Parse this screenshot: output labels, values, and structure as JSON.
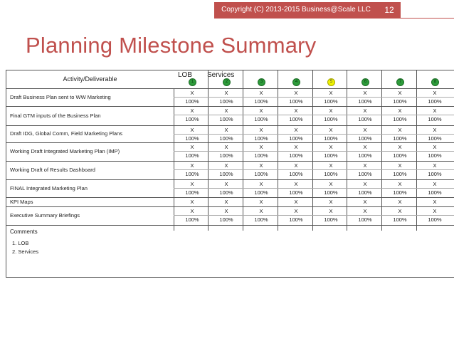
{
  "header": {
    "copyright": "Copyright (C) 2013-2015 Business@Scale LLC",
    "page_number": "12"
  },
  "title": "Planning Milestone Summary",
  "table": {
    "activity_header": "Activity/Deliverable",
    "group_labels": [
      "LOB",
      "Services"
    ],
    "milestones": [
      {
        "num": "1",
        "color": "#2d9b3a"
      },
      {
        "num": "2",
        "color": "#2d9b3a"
      },
      {
        "num": "3",
        "color": "#2d9b3a"
      },
      {
        "num": "4",
        "color": "#2d9b3a"
      },
      {
        "num": "5",
        "color": "#eef200"
      },
      {
        "num": "6",
        "color": "#2d9b3a"
      },
      {
        "num": "7",
        "color": "#2d9b3a"
      },
      {
        "num": "8",
        "color": "#2d9b3a"
      }
    ],
    "rows": [
      {
        "activity": "Draft Business Plan sent to WW Marketing",
        "marks": [
          "X",
          "X",
          "X",
          "X",
          "X",
          "X",
          "X",
          "X"
        ],
        "pct": [
          "100%",
          "100%",
          "100%",
          "100%",
          "100%",
          "100%",
          "100%",
          "100%"
        ]
      },
      {
        "activity": "Final GTM inputs of the Business Plan",
        "marks": [
          "X",
          "X",
          "X",
          "X",
          "X",
          "X",
          "X",
          "X"
        ],
        "pct": [
          "100%",
          "100%",
          "100%",
          "100%",
          "100%",
          "100%",
          "100%",
          "100%"
        ]
      },
      {
        "activity": "Draft IDG, Global Comm, Field Marketing Plans",
        "marks": [
          "X",
          "X",
          "X",
          "X",
          "X",
          "X",
          "X",
          "X"
        ],
        "pct": [
          "100%",
          "100%",
          "100%",
          "100%",
          "100%",
          "100%",
          "100%",
          "100%"
        ]
      },
      {
        "activity": "Working Draft Integrated Marketing Plan (IMP)",
        "marks": [
          "X",
          "X",
          "X",
          "X",
          "X",
          "X",
          "X",
          "X"
        ],
        "pct": [
          "100%",
          "100%",
          "100%",
          "100%",
          "100%",
          "100%",
          "100%",
          "100%"
        ]
      },
      {
        "activity": "Working Draft of Results Dashboard",
        "marks": [
          "X",
          "X",
          "X",
          "X",
          "X",
          "X",
          "X",
          "X"
        ],
        "pct": [
          "100%",
          "100%",
          "100%",
          "100%",
          "100%",
          "100%",
          "100%",
          "100%"
        ]
      },
      {
        "activity": "FINAL Integrated Marketing Plan",
        "marks": [
          "X",
          "X",
          "X",
          "X",
          "X",
          "X",
          "X",
          "X"
        ],
        "pct": [
          "100%",
          "100%",
          "100%",
          "100%",
          "100%",
          "100%",
          "100%",
          "100%"
        ]
      },
      {
        "activity": "KPI Maps",
        "marks": [
          "X",
          "X",
          "X",
          "X",
          "X",
          "X",
          "X",
          "X"
        ],
        "pct": []
      },
      {
        "activity": "Executive Summary Briefings",
        "marks": [
          "X",
          "X",
          "X",
          "X",
          "X",
          "X",
          "X",
          "X"
        ],
        "pct": [
          "100%",
          "100%",
          "100%",
          "100%",
          "100%",
          "100%",
          "100%",
          "100%"
        ]
      }
    ],
    "comments_label": "Comments",
    "comments": [
      "1.    LOB",
      "2.    Services"
    ]
  }
}
